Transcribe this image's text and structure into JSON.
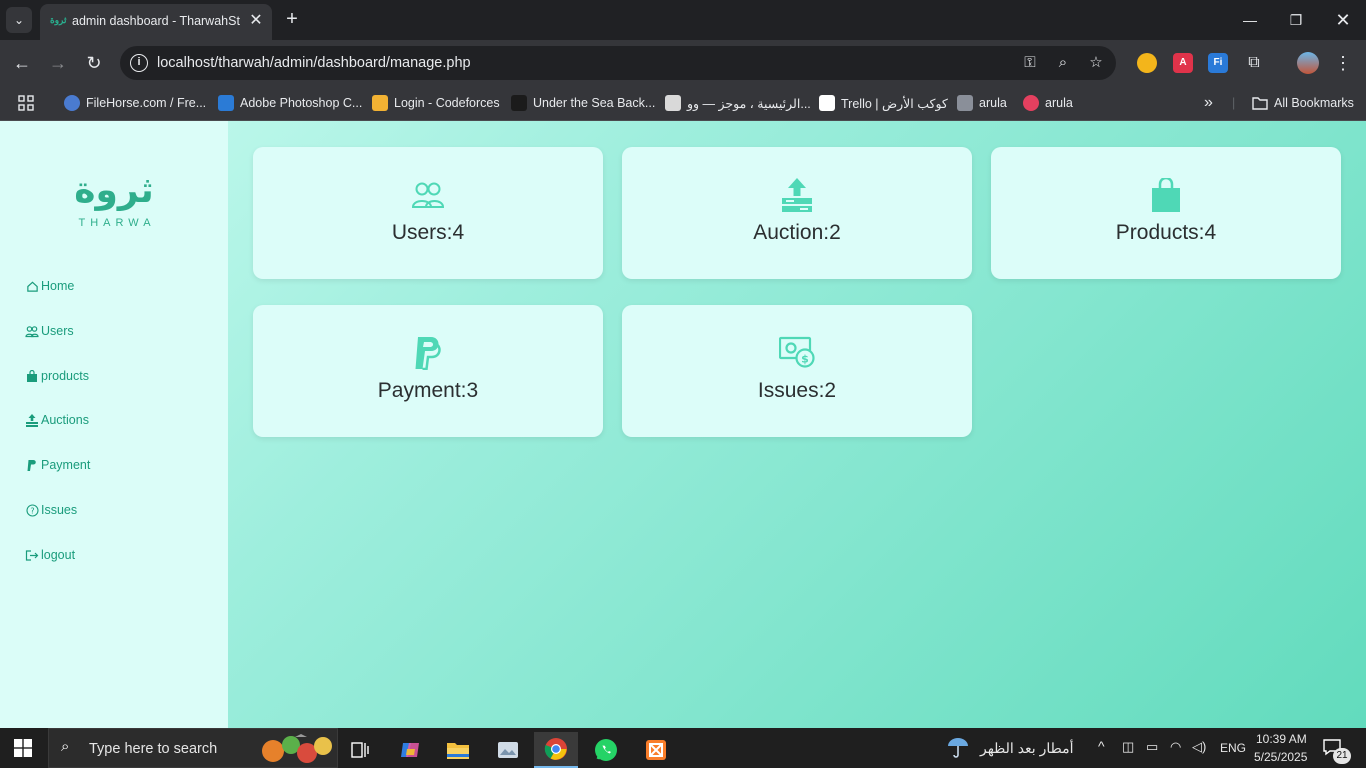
{
  "browser": {
    "tab_title": "admin dashboard - TharwahStore",
    "tab_favicon_text": "ثروة",
    "url": "localhost/tharwah/admin/dashboard/manage.php",
    "bookmarks": [
      {
        "label": "FileHorse.com / Fre...",
        "color": "#4a7bd0"
      },
      {
        "label": "Adobe Photoshop C...",
        "color": "#2b7bd6"
      },
      {
        "label": "Login - Codeforces",
        "color": "#f2b233"
      },
      {
        "label": "Under the Sea Back...",
        "color": "#1b1b1b"
      },
      {
        "label": "الرئيسية ، موجز — وو...",
        "color": "#d9d9d9"
      },
      {
        "label": "Trello | كوكب الأرض",
        "color": "#ffffff"
      },
      {
        "label": "arula",
        "color": "#8a8f99"
      },
      {
        "label": "arula",
        "color": "#e4405f"
      }
    ],
    "all_bookmarks_label": "All Bookmarks"
  },
  "sidebar": {
    "logo_arabic": "ثروة",
    "logo_sub": "THARWA",
    "items": [
      {
        "label": "Home",
        "icon": "home-icon"
      },
      {
        "label": "Users",
        "icon": "users-icon"
      },
      {
        "label": "products",
        "icon": "bag-icon"
      },
      {
        "label": "Auctions",
        "icon": "upload-icon"
      },
      {
        "label": "Payment",
        "icon": "paypal-icon"
      },
      {
        "label": "Issues",
        "icon": "help-icon"
      },
      {
        "label": "logout",
        "icon": "logout-icon"
      }
    ]
  },
  "cards": [
    {
      "label": "Users:4",
      "icon": "users-icon"
    },
    {
      "label": "Auction:2",
      "icon": "upload-icon"
    },
    {
      "label": "Products:4",
      "icon": "bag-icon"
    },
    {
      "label": "Payment:3",
      "icon": "paypal-icon"
    },
    {
      "label": "Issues:2",
      "icon": "money-icon"
    }
  ],
  "colors": {
    "accent": "#4fd8b6",
    "sidebar_text": "#1a9c7c",
    "card_bg": "#dcfdf9"
  },
  "taskbar": {
    "search_placeholder": "Type here to search",
    "weather": "أمطار بعد الظهر",
    "language": "ENG",
    "time": "10:39 AM",
    "date": "5/25/2025",
    "notifications": "21"
  }
}
